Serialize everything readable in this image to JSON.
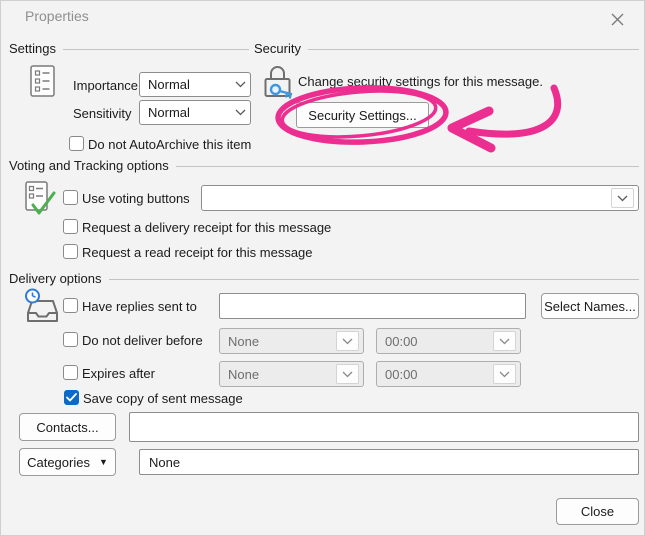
{
  "dialog": {
    "title": "Properties"
  },
  "settings": {
    "header": "Settings",
    "importance_label": "Importance",
    "importance_value": "Normal",
    "sensitivity_label": "Sensitivity",
    "sensitivity_value": "Normal",
    "autoarchive_label": "Do not AutoArchive this item",
    "autoarchive_checked": false
  },
  "security": {
    "header": "Security",
    "description": "Change security settings for this message.",
    "button_label": "Security Settings..."
  },
  "voting": {
    "header": "Voting and Tracking options",
    "use_voting_label": "Use voting buttons",
    "use_voting_checked": false,
    "voting_value": "",
    "delivery_receipt_label": "Request a delivery receipt for this message",
    "delivery_receipt_checked": false,
    "read_receipt_label": "Request a read receipt for this message",
    "read_receipt_checked": false
  },
  "delivery": {
    "header": "Delivery options",
    "have_replies_label": "Have replies sent to",
    "have_replies_checked": false,
    "replies_value": "",
    "select_names_label": "Select Names...",
    "do_not_deliver_label": "Do not deliver before",
    "do_not_deliver_checked": false,
    "deliver_date_value": "None",
    "deliver_time_value": "00:00",
    "expires_label": "Expires after",
    "expires_checked": false,
    "expires_date_value": "None",
    "expires_time_value": "00:00",
    "save_copy_label": "Save copy of sent message",
    "save_copy_checked": true
  },
  "footer": {
    "contacts_label": "Contacts...",
    "contacts_value": "",
    "categories_label": "Categories",
    "categories_value": "None",
    "close_label": "Close"
  },
  "colors": {
    "annotation_pink": "#ec2e90",
    "accent_blue": "#0b69c7",
    "check_green": "#4caf50",
    "key_blue": "#3f97e0",
    "clock_blue": "#2e7cd6"
  }
}
